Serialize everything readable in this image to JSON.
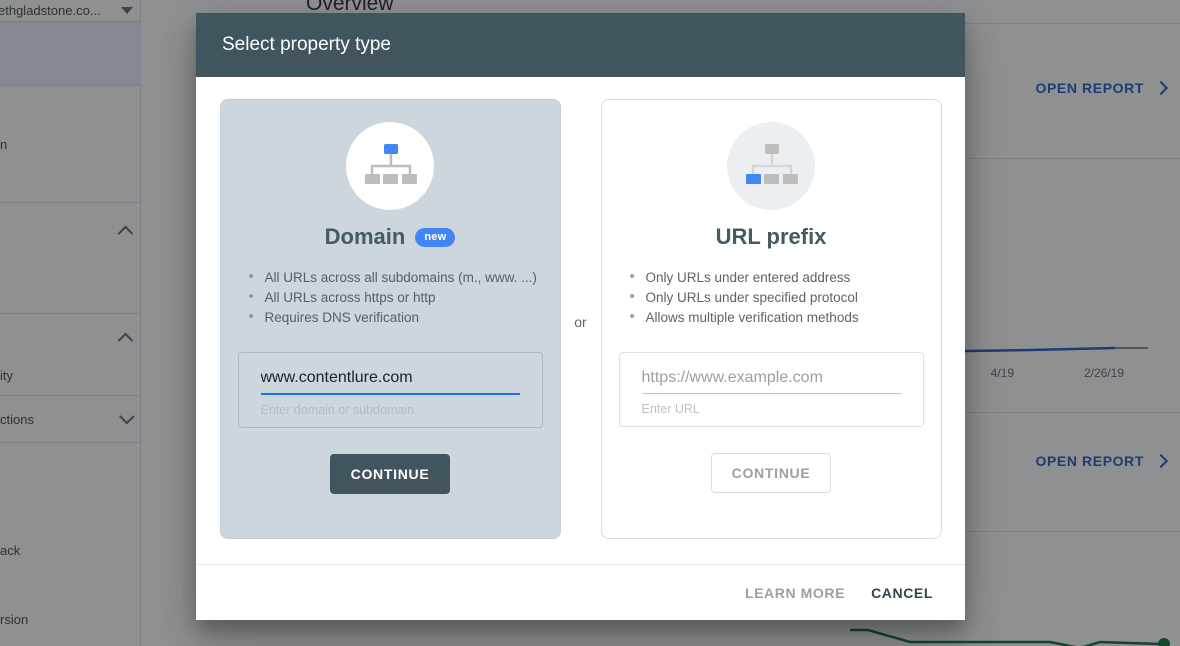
{
  "background": {
    "sidebar": {
      "account": {
        "label": "ethgladstone.co...",
        "icon": "caret-down-icon"
      },
      "items": [
        {
          "label": "",
          "state": "selected",
          "icon": ""
        },
        {
          "label": "n",
          "state": "normal",
          "icon": ""
        },
        {
          "label": "",
          "state": "normal",
          "icon": "chevron-up-icon"
        },
        {
          "label": "ity",
          "state": "normal",
          "icon": "chevron-up-icon"
        },
        {
          "label": "ctions",
          "state": "normal",
          "icon": "chevron-down-icon"
        },
        {
          "label": "ack",
          "state": "normal",
          "icon": ""
        },
        {
          "label": "rsion",
          "state": "normal",
          "icon": ""
        }
      ]
    },
    "main": {
      "page_title": "Overview",
      "open_report_label": "OPEN REPORT",
      "open_report_icon": "chevron-right-icon",
      "chart_axis_labels": [
        "4/19",
        "2/26/19"
      ]
    }
  },
  "modal": {
    "title": "Select property type",
    "divider_label": "or",
    "domain": {
      "icon": "site-hierarchy-icon",
      "title": "Domain",
      "badge": "new",
      "bullets": [
        "All URLs across all subdomains (m., www. ...)",
        "All URLs across https or http",
        "Requires DNS verification"
      ],
      "input_value": "www.contentlure.com",
      "input_placeholder": "",
      "input_help": "Enter domain or subdomain",
      "continue_label": "CONTINUE"
    },
    "urlprefix": {
      "icon": "site-hierarchy-icon",
      "title": "URL prefix",
      "bullets": [
        "Only URLs under entered address",
        "Only URLs under specified protocol",
        "Allows multiple verification methods"
      ],
      "input_value": "",
      "input_placeholder": "https://www.example.com",
      "input_help": "Enter URL",
      "continue_label": "CONTINUE"
    },
    "footer": {
      "learn_more_label": "LEARN MORE",
      "cancel_label": "CANCEL"
    }
  },
  "colors": {
    "header_bar": "#41555f",
    "domain_card_bg": "#ccd6dc",
    "accent_blue": "#4285f4",
    "input_underline": "#1a73e8",
    "link_blue": "#1a56c4",
    "chart_blue": "#1a56c4",
    "chart_green": "#0b6b3a"
  }
}
